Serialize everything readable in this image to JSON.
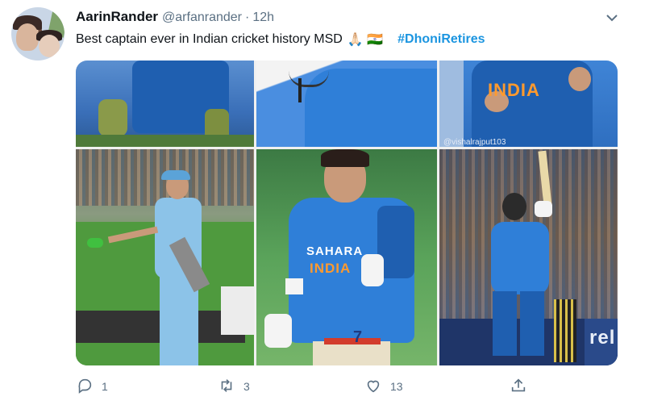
{
  "tweet": {
    "author_name": "AarinRander",
    "author_handle": "@arfanrander",
    "separator": "·",
    "timestamp": "12h",
    "text": "Best captain ever in Indian cricket history MSD",
    "emoji": "🙏🏻 🇮🇳",
    "hashtag": "#DhoniRetires"
  },
  "images": {
    "watermark": "@vishalrajput103",
    "tile3_jersey_text": "INDIA",
    "tile5_jersey_sponsor": "SAHARA",
    "tile5_jersey_text": "INDIA",
    "tile5_number": "7",
    "tile6_ad_text": "rel"
  },
  "actions": {
    "reply_count": "1",
    "retweet_count": "3",
    "like_count": "13",
    "share_count": ""
  },
  "colors": {
    "link": "#1b95e0",
    "secondary_text": "#5b7083",
    "jersey_blue": "#2f7fd8"
  },
  "icons": {
    "caret": "chevron-down-icon",
    "reply": "reply-icon",
    "retweet": "retweet-icon",
    "like": "heart-icon",
    "share": "share-icon"
  }
}
